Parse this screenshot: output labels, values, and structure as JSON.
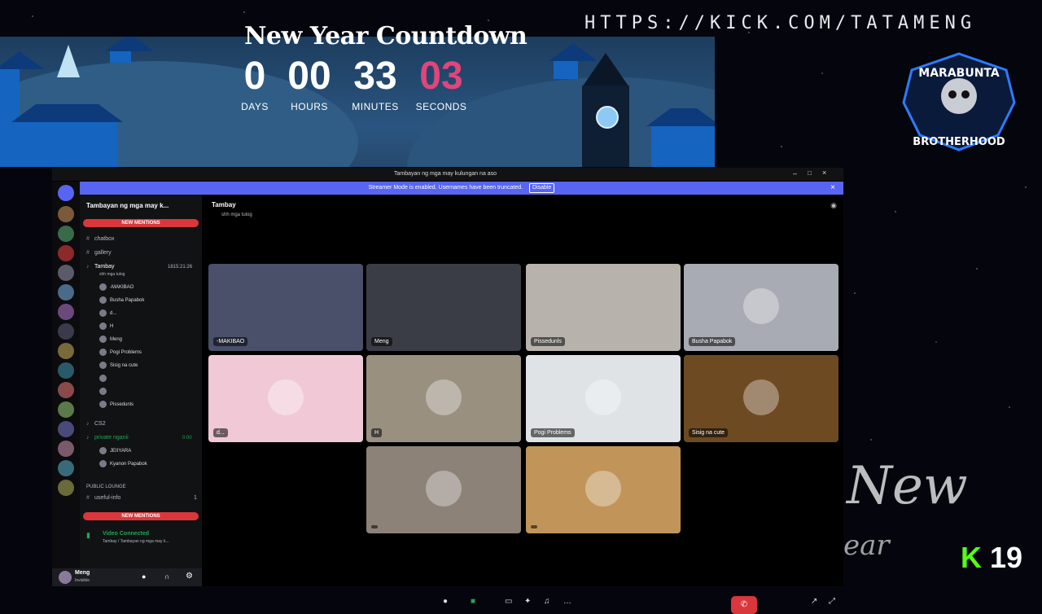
{
  "overlay": {
    "url": "HTTPS://KICK.COM/TATAMENG",
    "countdown_title": "New Year Countdown",
    "countdown": [
      {
        "value": "0",
        "unit": "DAYS"
      },
      {
        "value": "00",
        "unit": "HOURS"
      },
      {
        "value": "33",
        "unit": "MINUTES"
      },
      {
        "value": "03",
        "unit": "SECONDS"
      }
    ],
    "logo_top": "MARABUNTA",
    "logo_bottom": "BROTHERHOOD",
    "corner_script_1": "New",
    "corner_script_2": "ear",
    "kick_icon": "K",
    "kick_viewers": "19",
    "accent_seconds": "#e0457b"
  },
  "window": {
    "title": "Tambayan ng mga may kulungan na aso",
    "streamer_notice": "Streamer Mode is enabled. Usernames have been truncated.",
    "disable_label": "Disable"
  },
  "sidebar": {
    "server_name": "Tambayan ng mga may k...",
    "new_mentions": "NEW MENTIONS",
    "channels": [
      {
        "name": "chatbox",
        "icon": "#"
      },
      {
        "name": "gallery",
        "icon": "#"
      }
    ],
    "voice_channel": {
      "name": "Tambay",
      "timer": "1815:21:26",
      "status": "shh mga tulog"
    },
    "voice_users": [
      "-MAKIBAO",
      "Busha Papabok",
      "d...",
      "H",
      "Meng",
      "Pogi Problems",
      "Sisig na cute",
      "",
      "",
      "Pissedunls"
    ],
    "cs2": "CS2",
    "private": {
      "name": "private nganii",
      "timer": "0:00"
    },
    "private_users": [
      "JEIIYARA",
      "Kyanon Papabok"
    ],
    "category": "PUBLIC LOUNGE",
    "useful_info": "useful-info",
    "useful_count": "1",
    "voice_connected": "Video Connected",
    "voice_location": "Tambay / Tambayan ng mga may k...",
    "user": "Meng",
    "user_status": "Invisible"
  },
  "main": {
    "channel": "Tambay",
    "subtitle": "shh mga tulog",
    "tiles": [
      {
        "label": "-MAKIBAO",
        "bg": "#4a4f6a"
      },
      {
        "label": "Meng",
        "bg": "#3b3d46"
      },
      {
        "label": "Pissedunls",
        "bg": "#b7b3ac"
      },
      {
        "label": "Busha Papabok",
        "bg": "#a8abb4"
      },
      {
        "label": "d...",
        "bg": "#f1c9d6"
      },
      {
        "label": "H",
        "bg": "#9a9080"
      },
      {
        "label": "Pogi Problems",
        "bg": "#dfe3e6"
      },
      {
        "label": "Sisig na cute",
        "bg": "#6e4a22"
      },
      {
        "label": "",
        "bg": "#8c8278"
      },
      {
        "label": "",
        "bg": "#c1955a"
      }
    ]
  }
}
